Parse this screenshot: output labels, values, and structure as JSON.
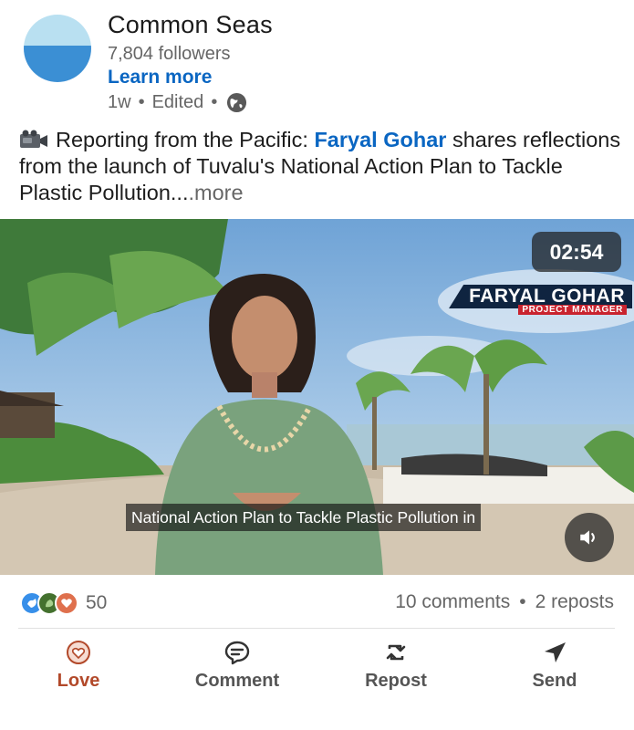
{
  "header": {
    "company": "Common Seas",
    "followers": "7,804 followers",
    "learn_more": "Learn more",
    "age": "1w",
    "edited": "Edited",
    "separator": "•"
  },
  "post": {
    "emoji": "video-camera-icon",
    "intro": "Reporting from the Pacific: ",
    "mention": "Faryal Gohar",
    "body": " shares reflections from the launch of Tuvalu's National Action Plan to Tackle Plastic Pollution...",
    "more": ".more"
  },
  "video": {
    "duration": "02:54",
    "lower_third_name": "FARYAL GOHAR",
    "lower_third_role": "PROJECT MANAGER",
    "caption": "National Action Plan to Tackle Plastic Pollution in",
    "sound_icon": "speaker-icon"
  },
  "social": {
    "reaction_icons": [
      "support-icon",
      "celebrate-icon",
      "love-icon"
    ],
    "reaction_count": "50",
    "comments": "10 comments",
    "reposts": "2 reposts",
    "separator": "•"
  },
  "actions": {
    "love": "Love",
    "comment": "Comment",
    "repost": "Repost",
    "send": "Send"
  },
  "colors": {
    "link": "#0a66c2",
    "love_active": "#b2492a",
    "lower_third_bg": "#0f2440",
    "lower_third_role_bg": "#c9232e"
  }
}
